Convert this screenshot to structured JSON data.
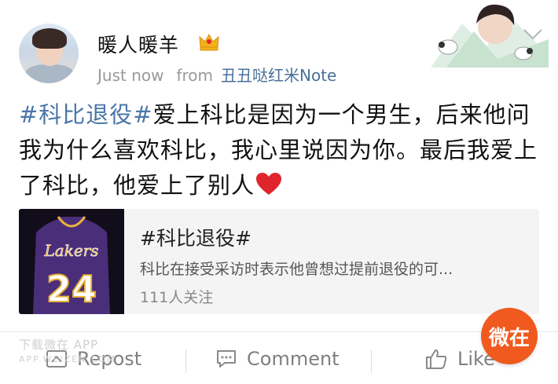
{
  "post": {
    "author": "暖人暖羊",
    "time": "Just now",
    "from_label": "from",
    "source": "丑丑哒红米Note",
    "hashtag": "#科比退役#",
    "body": "爱上科比是因为一个男生，后来他问我为什么喜欢科比，我心里说因为你。最后我爱上了科比，他爱上了别人"
  },
  "card": {
    "title": "#科比退役#",
    "description": "科比在接受采访时表示他曾想过提前退役的可...",
    "followers": "111人关注"
  },
  "actions": {
    "repost": "Repost",
    "comment": "Comment",
    "like": "Like"
  },
  "watermark": {
    "line1": "下载微在 APP",
    "line2": "APP.WEIZEN.COM"
  },
  "badge": {
    "label": "微在"
  },
  "colors": {
    "link": "#4a76a8",
    "source": "#4a6f9a",
    "badge": "#f05a1e",
    "heart": "#e0242b",
    "jersey": "#4b2e7a",
    "jersey_text": "#e9b43a"
  },
  "icons": [
    "crown-icon",
    "chevron-down-icon",
    "heart-icon",
    "repost-icon",
    "comment-icon",
    "like-icon"
  ]
}
